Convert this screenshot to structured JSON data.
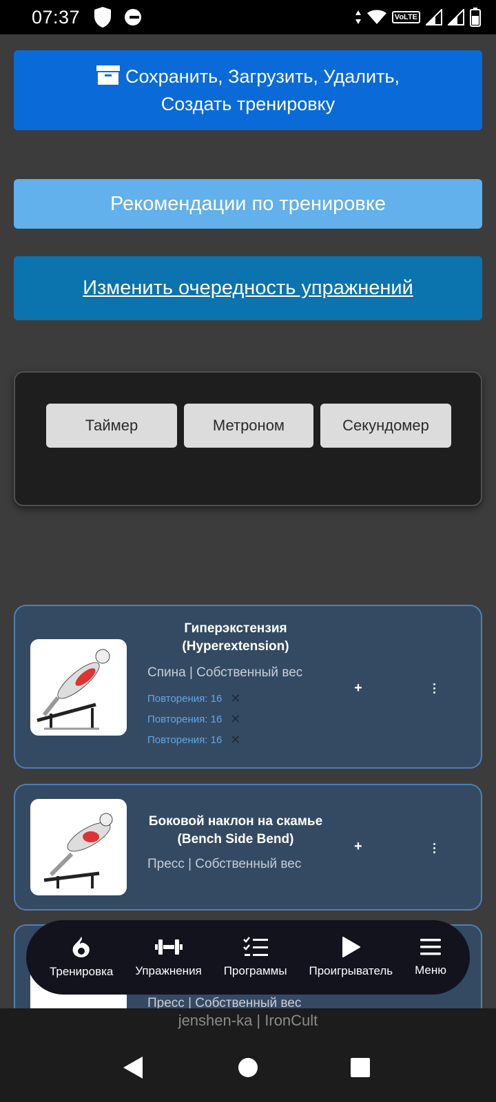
{
  "status_bar": {
    "time": "07:37",
    "network": "VoLTE"
  },
  "actions": {
    "save_line1": "Сохранить, Загрузить, Удалить,",
    "save_line2": "Создать тренировку",
    "recommendations": "Рекомендации по тренировке",
    "reorder": "Изменить очередность упражнений"
  },
  "tools": {
    "timer": "Таймер",
    "metronome": "Метроном",
    "stopwatch": "Секундомер"
  },
  "exercises": [
    {
      "title_ru": "Гиперэкстензия",
      "title_en": "(Hyperextension)",
      "meta": "Спина | Собственный вес",
      "sets": [
        "Повторения: 16",
        "Повторения: 16",
        "Повторения: 16"
      ],
      "add": "+"
    },
    {
      "title_ru": "Боковой наклон на скамье",
      "title_en": "(Bench Side Bend)",
      "meta": "Пресс | Собственный вес",
      "add": "+"
    },
    {
      "meta": "Пресс | Собственный вес"
    }
  ],
  "nav": {
    "workout": "Тренировка",
    "exercises": "Упражнения",
    "programs": "Программы",
    "player": "Проигрыватель",
    "menu": "Меню"
  },
  "credit": "jenshen-ka | IronCult",
  "icons": [
    "shield-icon",
    "circle-minus-icon",
    "wifi-icon",
    "signal-icon",
    "battery-icon",
    "archive-icon",
    "flame-icon",
    "dumbbell-icon",
    "checklist-icon",
    "play-icon",
    "hamburger-icon",
    "back-icon",
    "home-icon",
    "recents-icon"
  ],
  "colors": {
    "primary": "#0a6bd8",
    "light_blue": "#62b0ec",
    "dark_blue": "#0b73ae",
    "card": "#344a63"
  }
}
